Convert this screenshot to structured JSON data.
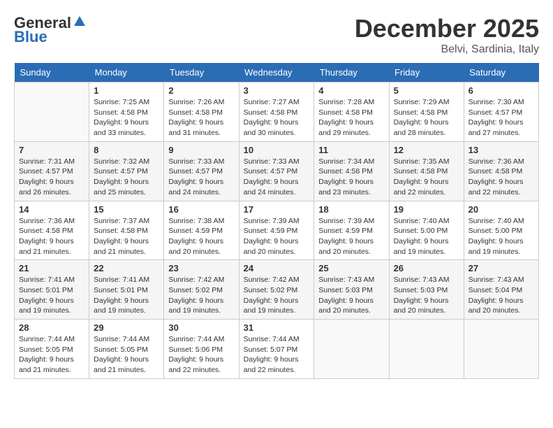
{
  "header": {
    "logo_general": "General",
    "logo_blue": "Blue",
    "month": "December 2025",
    "location": "Belvi, Sardinia, Italy"
  },
  "weekdays": [
    "Sunday",
    "Monday",
    "Tuesday",
    "Wednesday",
    "Thursday",
    "Friday",
    "Saturday"
  ],
  "weeks": [
    [
      {
        "day": "",
        "sunrise": "",
        "sunset": "",
        "daylight": ""
      },
      {
        "day": "1",
        "sunrise": "Sunrise: 7:25 AM",
        "sunset": "Sunset: 4:58 PM",
        "daylight": "Daylight: 9 hours and 33 minutes."
      },
      {
        "day": "2",
        "sunrise": "Sunrise: 7:26 AM",
        "sunset": "Sunset: 4:58 PM",
        "daylight": "Daylight: 9 hours and 31 minutes."
      },
      {
        "day": "3",
        "sunrise": "Sunrise: 7:27 AM",
        "sunset": "Sunset: 4:58 PM",
        "daylight": "Daylight: 9 hours and 30 minutes."
      },
      {
        "day": "4",
        "sunrise": "Sunrise: 7:28 AM",
        "sunset": "Sunset: 4:58 PM",
        "daylight": "Daylight: 9 hours and 29 minutes."
      },
      {
        "day": "5",
        "sunrise": "Sunrise: 7:29 AM",
        "sunset": "Sunset: 4:58 PM",
        "daylight": "Daylight: 9 hours and 28 minutes."
      },
      {
        "day": "6",
        "sunrise": "Sunrise: 7:30 AM",
        "sunset": "Sunset: 4:57 PM",
        "daylight": "Daylight: 9 hours and 27 minutes."
      }
    ],
    [
      {
        "day": "7",
        "sunrise": "Sunrise: 7:31 AM",
        "sunset": "Sunset: 4:57 PM",
        "daylight": "Daylight: 9 hours and 26 minutes."
      },
      {
        "day": "8",
        "sunrise": "Sunrise: 7:32 AM",
        "sunset": "Sunset: 4:57 PM",
        "daylight": "Daylight: 9 hours and 25 minutes."
      },
      {
        "day": "9",
        "sunrise": "Sunrise: 7:33 AM",
        "sunset": "Sunset: 4:57 PM",
        "daylight": "Daylight: 9 hours and 24 minutes."
      },
      {
        "day": "10",
        "sunrise": "Sunrise: 7:33 AM",
        "sunset": "Sunset: 4:57 PM",
        "daylight": "Daylight: 9 hours and 24 minutes."
      },
      {
        "day": "11",
        "sunrise": "Sunrise: 7:34 AM",
        "sunset": "Sunset: 4:58 PM",
        "daylight": "Daylight: 9 hours and 23 minutes."
      },
      {
        "day": "12",
        "sunrise": "Sunrise: 7:35 AM",
        "sunset": "Sunset: 4:58 PM",
        "daylight": "Daylight: 9 hours and 22 minutes."
      },
      {
        "day": "13",
        "sunrise": "Sunrise: 7:36 AM",
        "sunset": "Sunset: 4:58 PM",
        "daylight": "Daylight: 9 hours and 22 minutes."
      }
    ],
    [
      {
        "day": "14",
        "sunrise": "Sunrise: 7:36 AM",
        "sunset": "Sunset: 4:58 PM",
        "daylight": "Daylight: 9 hours and 21 minutes."
      },
      {
        "day": "15",
        "sunrise": "Sunrise: 7:37 AM",
        "sunset": "Sunset: 4:58 PM",
        "daylight": "Daylight: 9 hours and 21 minutes."
      },
      {
        "day": "16",
        "sunrise": "Sunrise: 7:38 AM",
        "sunset": "Sunset: 4:59 PM",
        "daylight": "Daylight: 9 hours and 20 minutes."
      },
      {
        "day": "17",
        "sunrise": "Sunrise: 7:39 AM",
        "sunset": "Sunset: 4:59 PM",
        "daylight": "Daylight: 9 hours and 20 minutes."
      },
      {
        "day": "18",
        "sunrise": "Sunrise: 7:39 AM",
        "sunset": "Sunset: 4:59 PM",
        "daylight": "Daylight: 9 hours and 20 minutes."
      },
      {
        "day": "19",
        "sunrise": "Sunrise: 7:40 AM",
        "sunset": "Sunset: 5:00 PM",
        "daylight": "Daylight: 9 hours and 19 minutes."
      },
      {
        "day": "20",
        "sunrise": "Sunrise: 7:40 AM",
        "sunset": "Sunset: 5:00 PM",
        "daylight": "Daylight: 9 hours and 19 minutes."
      }
    ],
    [
      {
        "day": "21",
        "sunrise": "Sunrise: 7:41 AM",
        "sunset": "Sunset: 5:01 PM",
        "daylight": "Daylight: 9 hours and 19 minutes."
      },
      {
        "day": "22",
        "sunrise": "Sunrise: 7:41 AM",
        "sunset": "Sunset: 5:01 PM",
        "daylight": "Daylight: 9 hours and 19 minutes."
      },
      {
        "day": "23",
        "sunrise": "Sunrise: 7:42 AM",
        "sunset": "Sunset: 5:02 PM",
        "daylight": "Daylight: 9 hours and 19 minutes."
      },
      {
        "day": "24",
        "sunrise": "Sunrise: 7:42 AM",
        "sunset": "Sunset: 5:02 PM",
        "daylight": "Daylight: 9 hours and 19 minutes."
      },
      {
        "day": "25",
        "sunrise": "Sunrise: 7:43 AM",
        "sunset": "Sunset: 5:03 PM",
        "daylight": "Daylight: 9 hours and 20 minutes."
      },
      {
        "day": "26",
        "sunrise": "Sunrise: 7:43 AM",
        "sunset": "Sunset: 5:03 PM",
        "daylight": "Daylight: 9 hours and 20 minutes."
      },
      {
        "day": "27",
        "sunrise": "Sunrise: 7:43 AM",
        "sunset": "Sunset: 5:04 PM",
        "daylight": "Daylight: 9 hours and 20 minutes."
      }
    ],
    [
      {
        "day": "28",
        "sunrise": "Sunrise: 7:44 AM",
        "sunset": "Sunset: 5:05 PM",
        "daylight": "Daylight: 9 hours and 21 minutes."
      },
      {
        "day": "29",
        "sunrise": "Sunrise: 7:44 AM",
        "sunset": "Sunset: 5:05 PM",
        "daylight": "Daylight: 9 hours and 21 minutes."
      },
      {
        "day": "30",
        "sunrise": "Sunrise: 7:44 AM",
        "sunset": "Sunset: 5:06 PM",
        "daylight": "Daylight: 9 hours and 22 minutes."
      },
      {
        "day": "31",
        "sunrise": "Sunrise: 7:44 AM",
        "sunset": "Sunset: 5:07 PM",
        "daylight": "Daylight: 9 hours and 22 minutes."
      },
      {
        "day": "",
        "sunrise": "",
        "sunset": "",
        "daylight": ""
      },
      {
        "day": "",
        "sunrise": "",
        "sunset": "",
        "daylight": ""
      },
      {
        "day": "",
        "sunrise": "",
        "sunset": "",
        "daylight": ""
      }
    ]
  ]
}
